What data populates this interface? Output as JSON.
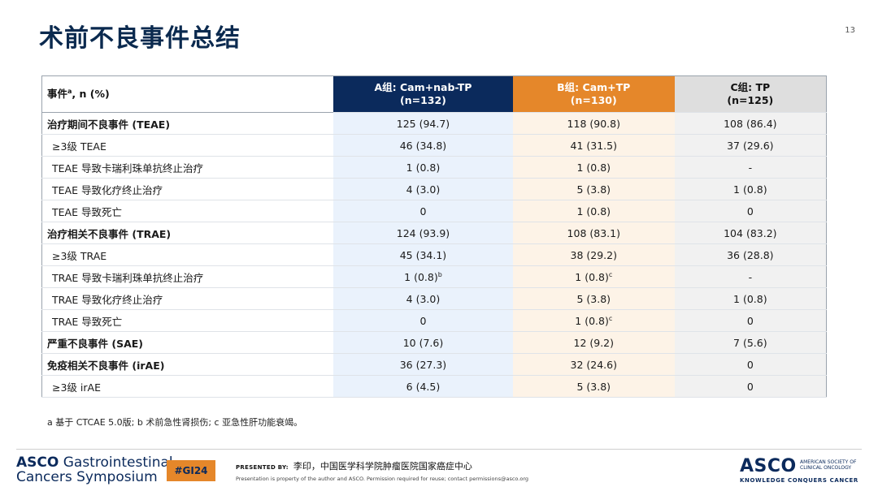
{
  "title": "术前不良事件总结",
  "page_number": "13",
  "table": {
    "header": {
      "label_main": "事件",
      "label_sup": "a",
      "label_rest": ", n (%)",
      "col_a": [
        "A组: Cam+nab-TP",
        "(n=132)"
      ],
      "col_b": [
        "B组: Cam+TP",
        "(n=130)"
      ],
      "col_c": [
        "C组: TP",
        "(n=125)"
      ]
    },
    "rows": [
      {
        "label": "治疗期间不良事件 (TEAE)",
        "a": "125 (94.7)",
        "b": "118 (90.8)",
        "c": "108 (86.4)"
      },
      {
        "label": "≥3级 TEAE",
        "a": "46 (34.8)",
        "b": "41 (31.5)",
        "c": "37 (29.6)"
      },
      {
        "label": "TEAE 导致卡瑞利珠单抗终止治疗",
        "a": "1 (0.8)",
        "b": "1 (0.8)",
        "c": "-"
      },
      {
        "label": "TEAE 导致化疗终止治疗",
        "a": "4 (3.0)",
        "b": "5 (3.8)",
        "c": "1 (0.8)"
      },
      {
        "label": "TEAE 导致死亡",
        "a": "0",
        "b": "1 (0.8)",
        "c": "0"
      },
      {
        "label": "治疗相关不良事件 (TRAE)",
        "a": "124 (93.9)",
        "b": "108 (83.1)",
        "c": "104 (83.2)"
      },
      {
        "label": "≥3级 TRAE",
        "a": "45 (34.1)",
        "b": "38 (29.2)",
        "c": "36 (28.8)"
      },
      {
        "label": "TRAE 导致卡瑞利珠单抗终止治疗",
        "a": "1 (0.8)",
        "a_sup": "b",
        "b": "1 (0.8)",
        "b_sup": "c",
        "c": "-"
      },
      {
        "label": "TRAE 导致化疗终止治疗",
        "a": "4 (3.0)",
        "b": "5 (3.8)",
        "c": "1 (0.8)"
      },
      {
        "label": "TRAE 导致死亡",
        "a": "0",
        "b": "1 (0.8)",
        "b_sup": "c",
        "c": "0"
      },
      {
        "label": "严重不良事件 (SAE)",
        "a": "10 (7.6)",
        "b": "12 (9.2)",
        "c": "7 (5.6)"
      },
      {
        "label": "免疫相关不良事件 (irAE)",
        "a": "36 (27.3)",
        "b": "32 (24.6)",
        "c": "0"
      },
      {
        "label": "≥3级 irAE",
        "a": "6 (4.5)",
        "b": "5 (3.8)",
        "c": "0"
      }
    ]
  },
  "footnote": "a 基于 CTCAE 5.0版; b 术前急性肾损伤; c 亚急性肝功能衰竭。",
  "footer": {
    "logo_left_line1_bold": "ASCO",
    "logo_left_line1_rest": " Gastrointestinal",
    "logo_left_line2": "Cancers Symposium",
    "tag": "#GI24",
    "presented_by": "PRESENTED BY:",
    "presenter": "李印，中国医学科学院肿瘤医院国家癌症中心",
    "property": "Presentation is property of the author and ASCO. Permission required for reuse; contact permissions@asco.org",
    "logo_right": "ASCO",
    "logo_right_society": "AMERICAN SOCIETY OF CLINICAL ONCOLOGY",
    "logo_right_tagline": "KNOWLEDGE CONQUERS CANCER"
  },
  "colors": {
    "title": "#0b2a4f",
    "col_a_header": "#0b2a5c",
    "col_b_header": "#e5872a",
    "col_c_header": "#dedede"
  }
}
